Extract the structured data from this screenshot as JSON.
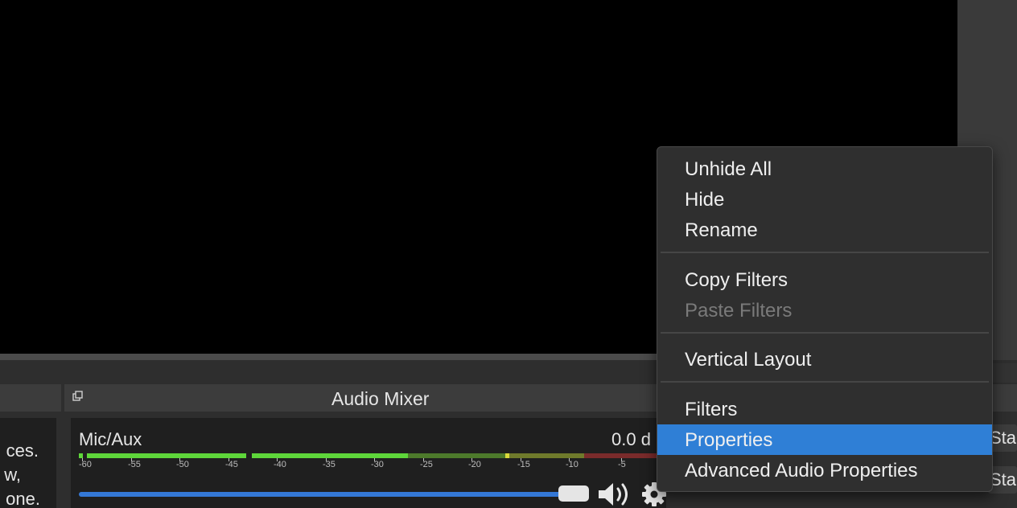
{
  "preview_label": "",
  "dock": {
    "title": "Audio Mixer"
  },
  "left_panel": {
    "lines": [
      "ces.",
      "w,",
      "one."
    ]
  },
  "mixer": {
    "channel_name": "Mic/Aux",
    "db_value": "0.0 d",
    "ticks": [
      "-60",
      "-55",
      "-50",
      "-45",
      "-40",
      "-35",
      "-30",
      "-25",
      "-20",
      "-15",
      "-10",
      "-5"
    ],
    "volume_fraction": 0.97,
    "meter_colors": {
      "green": "#5ed63a",
      "yellow": "#d9d93a",
      "red": "#c83a3a",
      "green_dim": "#4d7a2b",
      "yellow_dim": "#8a8a2b",
      "red_dim": "#7a2b2b"
    }
  },
  "right_buttons": [
    "Sta",
    "Sta"
  ],
  "context_menu": {
    "items": [
      {
        "label": "Unhide All",
        "enabled": true
      },
      {
        "label": "Hide",
        "enabled": true
      },
      {
        "label": "Rename",
        "enabled": true
      },
      {
        "label": "Copy Filters",
        "enabled": true
      },
      {
        "label": "Paste Filters",
        "enabled": false
      },
      {
        "label": "Vertical Layout",
        "enabled": true
      },
      {
        "label": "Filters",
        "enabled": true
      },
      {
        "label": "Properties",
        "enabled": true,
        "selected": true
      },
      {
        "label": "Advanced Audio Properties",
        "enabled": true
      }
    ],
    "accent": "#2f7fd6"
  },
  "icons": {
    "undock": "undock-icon",
    "speaker": "speaker-icon",
    "gear": "gear-icon"
  }
}
